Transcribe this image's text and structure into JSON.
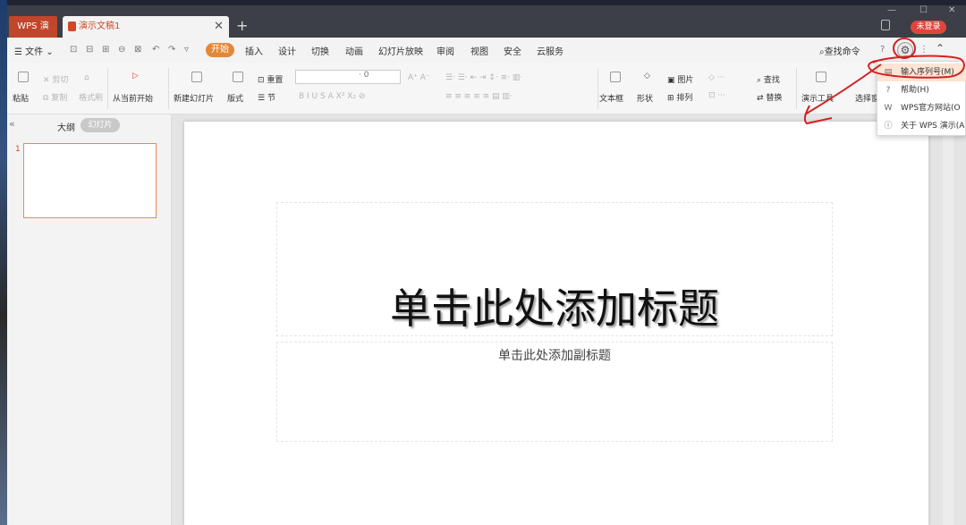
{
  "titlebar": {
    "app_tab": "WPS 演示",
    "doc_tab": "演示文稿1",
    "close_tab": "✕",
    "add_tab": "+",
    "window_controls": [
      "—",
      "☐",
      "✕"
    ],
    "login": "未登录"
  },
  "menubar": {
    "file": "文件",
    "items": [
      "开始",
      "插入",
      "设计",
      "切换",
      "动画",
      "幻灯片放映",
      "审阅",
      "视图",
      "安全",
      "云服务"
    ],
    "find_command": "查找命令"
  },
  "ribbon": {
    "paste": "粘贴",
    "cut": "剪切",
    "copy": "复制",
    "format_painter": "格式刷",
    "from_current": "从当前开始",
    "new_slide": "新建幻灯片",
    "layout": "版式",
    "reset": "重置",
    "section": "节",
    "font_size": "0",
    "text_box": "文本框",
    "shape": "形状",
    "picture": "图片",
    "arrange": "排列",
    "find": "查找",
    "replace": "替换",
    "presentation_tools": "演示工具",
    "select_pane": "选择窗"
  },
  "left_panel": {
    "outline_tab": "大纲",
    "slides_tab": "幻灯片",
    "slide_number": "1"
  },
  "slide": {
    "title_placeholder": "单击此处添加标题",
    "subtitle_placeholder": "单击此处添加副标题"
  },
  "dropdown": {
    "items": [
      {
        "icon": "serial-number-icon",
        "label": "输入序列号(M)"
      },
      {
        "icon": "help-icon",
        "label": "帮助(H)"
      },
      {
        "icon": "wps-logo-icon",
        "label": "WPS官方网站(O"
      },
      {
        "icon": "about-icon",
        "label": "关于 WPS 演示(A"
      }
    ]
  },
  "annotation_color": "#d42020"
}
